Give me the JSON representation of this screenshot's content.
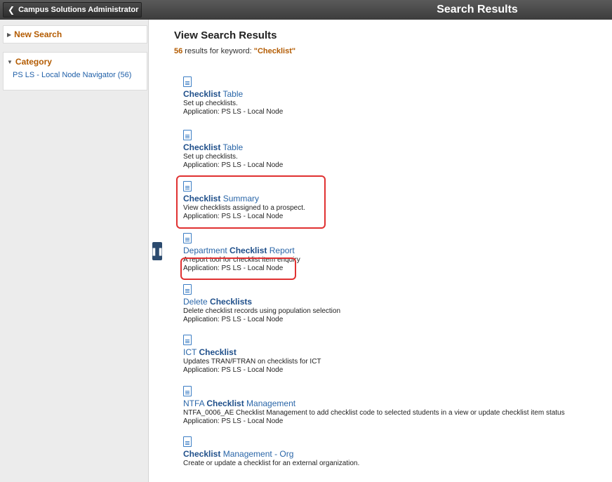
{
  "topbar": {
    "back_label": "Campus Solutions Administrator",
    "title": "Search Results"
  },
  "sidebar": {
    "new_search": "New Search",
    "category": "Category",
    "category_link": "PS LS - Local Node Navigator (56)"
  },
  "main": {
    "title": "View Search Results",
    "count": "56",
    "summary_text": " results for keyword: ",
    "keyword": "\"Checklist\""
  },
  "results": [
    {
      "t1": "",
      "tb": "Checklist",
      "t2": " Table",
      "desc": "Set up checklists.",
      "app": "Application: PS LS - Local Node"
    },
    {
      "t1": "",
      "tb": "Checklist",
      "t2": " Table",
      "desc": "Set up checklists.",
      "app": "Application: PS LS - Local Node"
    },
    {
      "t1": "",
      "tb": "Checklist",
      "t2": " Summary",
      "desc": "View checklists assigned to a prospect.",
      "app": "Application: PS LS - Local Node"
    },
    {
      "t1": "Department ",
      "tb": "Checklist",
      "t2": " Report",
      "desc": "A report tool for checklist item enquiry",
      "app": "Application: PS LS - Local Node"
    },
    {
      "t1": "Delete ",
      "tb": "Checklists",
      "t2": "",
      "desc": "Delete checklist records using population selection",
      "app": "Application: PS LS - Local Node"
    },
    {
      "t1": "ICT ",
      "tb": "Checklist",
      "t2": "",
      "desc": "Updates TRAN/FTRAN on checklists for ICT",
      "app": "Application: PS LS - Local Node"
    },
    {
      "t1": "NTFA ",
      "tb": "Checklist",
      "t2": " Management",
      "desc": "NTFA_0006_AE Checklist Management to add checklist code to selected students in a view or update checklist item status",
      "app": "Application: PS LS - Local Node"
    },
    {
      "t1": "",
      "tb": "Checklist",
      "t2": " Management - Org",
      "desc": "Create or update a checklist for an external organization.",
      "app": ""
    }
  ]
}
